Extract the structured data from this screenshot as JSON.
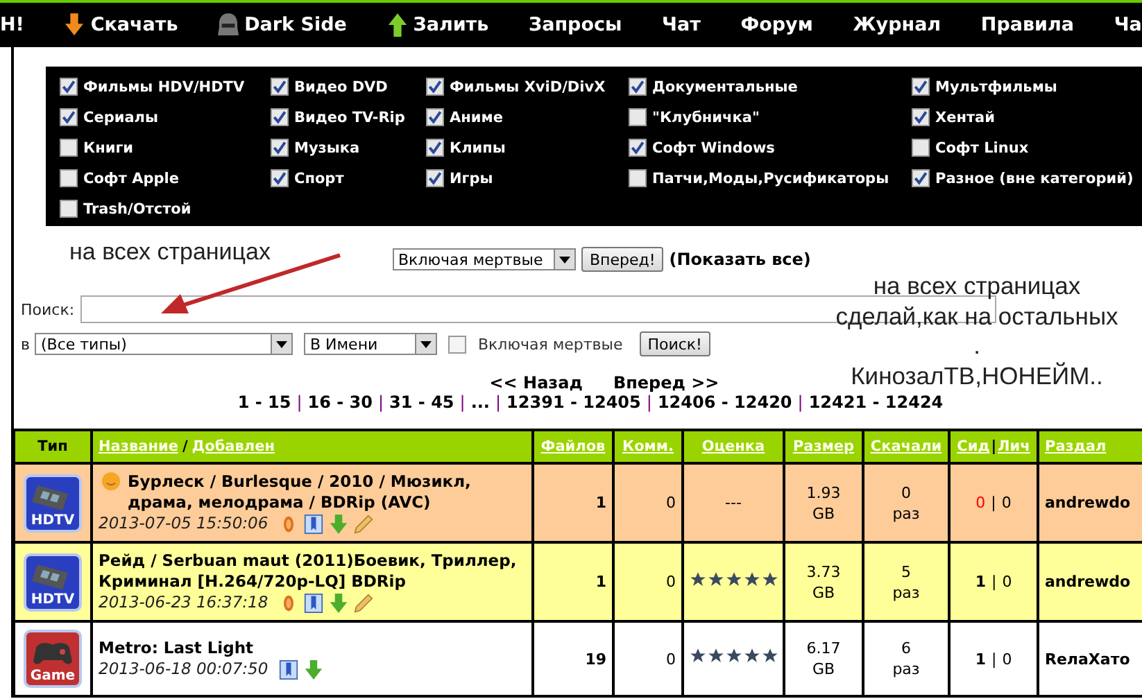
{
  "nav": [
    {
      "label": "Н!",
      "kind": "plain"
    },
    {
      "label": "Скачать",
      "kind": "download"
    },
    {
      "label": "Dark Side",
      "kind": "helmet"
    },
    {
      "label": "Залить",
      "kind": "upload"
    },
    {
      "label": "Запросы",
      "kind": "plain"
    },
    {
      "label": "Чат",
      "kind": "plain"
    },
    {
      "label": "Форум",
      "kind": "plain"
    },
    {
      "label": "Журнал",
      "kind": "plain"
    },
    {
      "label": "Правила",
      "kind": "plain"
    },
    {
      "label": "Ча",
      "kind": "plain"
    }
  ],
  "categories": [
    {
      "label": "Фильмы HDV/HDTV",
      "checked": true
    },
    {
      "label": "Видео DVD",
      "checked": true
    },
    {
      "label": "Фильмы XviD/DivX",
      "checked": true
    },
    {
      "label": "Документальные",
      "checked": true
    },
    {
      "label": "Мультфильмы",
      "checked": true
    },
    {
      "label": "Сериалы",
      "checked": true
    },
    {
      "label": "Видео TV-Rip",
      "checked": true
    },
    {
      "label": "Аниме",
      "checked": true
    },
    {
      "label": "\"Клубничка\"",
      "checked": false
    },
    {
      "label": "Хентай",
      "checked": true
    },
    {
      "label": "Книги",
      "checked": false
    },
    {
      "label": "Музыка",
      "checked": true
    },
    {
      "label": "Клипы",
      "checked": true
    },
    {
      "label": "Софт Windows",
      "checked": true
    },
    {
      "label": "Софт Linux",
      "checked": false
    },
    {
      "label": "Софт Apple",
      "checked": false
    },
    {
      "label": "Спорт",
      "checked": true
    },
    {
      "label": "Игры",
      "checked": true
    },
    {
      "label": "Патчи,Моды,Русификаторы",
      "checked": false
    },
    {
      "label": "Разное (вне категорий)",
      "checked": true
    },
    {
      "label": "Trash/Отстой",
      "checked": false
    }
  ],
  "annotations": {
    "left": "на всех страницах",
    "right": [
      "на всех страницах",
      "сделай,как на остальных",
      ".",
      "КинозалТВ,НОНЕЙМ.."
    ]
  },
  "filter": {
    "select": "Включая мертвые",
    "button": "Вперед!",
    "show_all": "(Показать все)"
  },
  "search": {
    "label": "Поиск:",
    "in_label": "в",
    "type_select": "(Все типы)",
    "field_select": "В Имени",
    "dead_label": "Включая мертвые",
    "dead_checked": false,
    "button": "Поиск!"
  },
  "pagination": {
    "prev": "<< Назад",
    "next": "Вперед >>",
    "separator": "|",
    "pages": [
      "1 - 15",
      "16 - 30",
      "31 - 45",
      "...",
      "12391 - 12405",
      "12406 - 12420",
      "12421 - 12424"
    ]
  },
  "table": {
    "cell_separator": "|",
    "columns": [
      {
        "parts": [
          "Тип"
        ],
        "link": false
      },
      {
        "parts": [
          "Название",
          "Добавлен"
        ],
        "separator": "/",
        "link": true
      },
      {
        "parts": [
          "Файлов"
        ],
        "link": true
      },
      {
        "parts": [
          "Комм."
        ],
        "link": true
      },
      {
        "parts": [
          "Оценка"
        ],
        "link": true
      },
      {
        "parts": [
          "Размер"
        ],
        "link": true
      },
      {
        "parts": [
          "Скачали"
        ],
        "link": true
      },
      {
        "parts": [
          "Сид",
          "Лич"
        ],
        "separator": "|",
        "link": true
      },
      {
        "parts": [
          "Раздал"
        ],
        "link": true
      }
    ],
    "rows": [
      {
        "color": "#fecc99",
        "type": {
          "kind": "hdtv",
          "label": "HDTV"
        },
        "smiley": true,
        "title": "Бурлеск / Burlesque / 2010 / Мюзикл, драма, мелодрама / BDRip (AVC)",
        "actions": [
          {
            "kind": "coin"
          },
          {
            "kind": "bookmark"
          },
          {
            "kind": "download"
          },
          {
            "kind": "pencil"
          }
        ],
        "date": "2013-07-05 15:50:06",
        "files": "1",
        "comments": "0",
        "rating": "---",
        "size": "1.93",
        "size_unit": "GB",
        "downloads": "0",
        "downloads_unit": "раз",
        "seeders": {
          "text": "0",
          "color": "#ff0000",
          "bold": false
        },
        "leechers": "0",
        "uploader": "andrewdo"
      },
      {
        "color": "#ffff99",
        "type": {
          "kind": "hdtv",
          "label": "HDTV"
        },
        "smiley": false,
        "title": "Рейд / Serbuan maut (2011)Боевик, Триллер, Криминал [H.264/720p-LQ] BDRip",
        "actions": [
          {
            "kind": "coin"
          },
          {
            "kind": "bookmark"
          },
          {
            "kind": "download"
          },
          {
            "kind": "pencil"
          }
        ],
        "date": "2013-06-23 16:37:18",
        "files": "1",
        "comments": "0",
        "stars": 5,
        "size": "3.73",
        "size_unit": "GB",
        "downloads": "5",
        "downloads_unit": "раз",
        "seeders": {
          "text": "1",
          "color": "#000000",
          "bold": true
        },
        "leechers": "0",
        "uploader": "andrewdo"
      },
      {
        "color": "#ffffff",
        "type": {
          "kind": "game",
          "label": "Game"
        },
        "smiley": false,
        "title": "Metro: Last Light",
        "actions": [
          {
            "kind": "bookmark"
          },
          {
            "kind": "download"
          }
        ],
        "date": "2013-06-18 00:07:50",
        "files": "19",
        "comments": "0",
        "stars": 5,
        "size": "6.17",
        "size_unit": "GB",
        "downloads": "6",
        "downloads_unit": "раз",
        "seeders": {
          "text": "1",
          "color": "#000000",
          "bold": true
        },
        "leechers": "0",
        "uploader": "RелаХато"
      }
    ]
  }
}
